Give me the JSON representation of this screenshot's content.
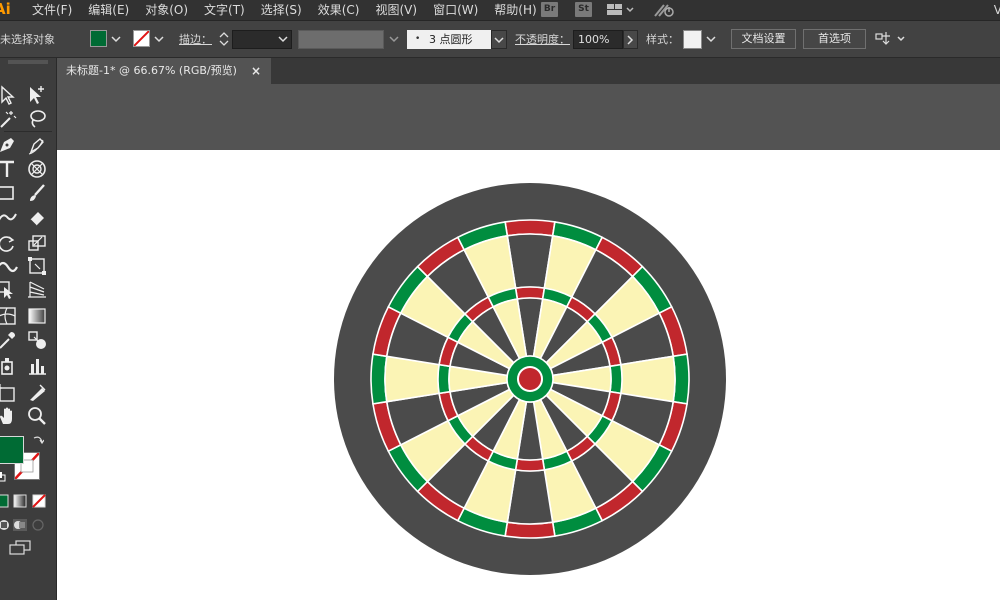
{
  "app": {
    "logo": "Ai",
    "menus": [
      "文件(F)",
      "编辑(E)",
      "对象(O)",
      "文字(T)",
      "选择(S)",
      "效果(C)",
      "视图(V)",
      "窗口(W)",
      "帮助(H)"
    ],
    "badges": [
      "Br",
      "St"
    ],
    "right_text": "V"
  },
  "control_bar": {
    "selection_status": "未选择对象",
    "fill_color": "#006b34",
    "stroke_label": "描边：",
    "brush_label": "3 点圆形",
    "opacity_label": "不透明度：",
    "opacity_value": "100%",
    "style_label": "样式：",
    "doc_setup_button": "文档设置",
    "preferences_button": "首选项"
  },
  "tab": {
    "title": "未标题-1* @ 66.67% (RGB/预览)",
    "close": "×"
  },
  "toolbox": {
    "fill_color": "#006b34"
  },
  "artwork": {
    "name": "dartboard",
    "colors": {
      "surround": "#4b4b4b",
      "dark_segment": "#4b4b4b",
      "light_segment": "#fbf4b5",
      "red": "#c1272d",
      "green": "#008d3f",
      "wire": "#ffffff"
    },
    "segments": 20
  }
}
